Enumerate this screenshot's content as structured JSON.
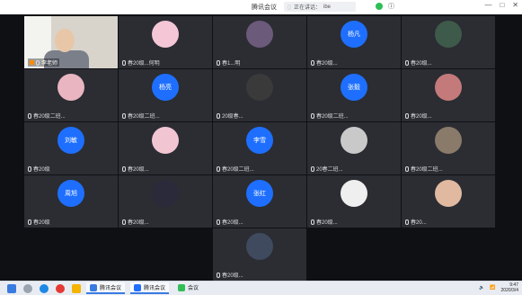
{
  "window": {
    "title": "腾讯会议",
    "speaking_label": "正在讲话：",
    "speaking_name": "ibe",
    "controls": [
      "—",
      "□",
      "✕"
    ]
  },
  "participants": [
    {
      "name": "李老师",
      "type": "video",
      "host": true
    },
    {
      "name": "春20级...何明",
      "type": "avatar",
      "color": "#f5c6d6"
    },
    {
      "name": "春1...明",
      "type": "avatar",
      "color": "#6b5a7a"
    },
    {
      "name": "春20级...",
      "type": "text",
      "avatar_text": "杨凡"
    },
    {
      "name": "春20级...",
      "type": "avatar",
      "color": "#3d5a4a"
    },
    {
      "name": "春20级二班...",
      "type": "avatar",
      "color": "#e8b5c0"
    },
    {
      "name": "春20级二班...",
      "type": "text",
      "avatar_text": "杨亮"
    },
    {
      "name": "20级春...",
      "type": "avatar",
      "color": "#3a3a3a"
    },
    {
      "name": "春20级二班...",
      "type": "text",
      "avatar_text": "张毅"
    },
    {
      "name": "春20级...",
      "type": "avatar",
      "color": "#c47a7a"
    },
    {
      "name": "春20级",
      "type": "text",
      "avatar_text": "刘敏"
    },
    {
      "name": "春20级...",
      "type": "avatar",
      "color": "#f2c5d2"
    },
    {
      "name": "春20级二班...",
      "type": "text",
      "avatar_text": "李雪"
    },
    {
      "name": "20春二班...",
      "type": "avatar",
      "color": "#c9c9c9"
    },
    {
      "name": "春20级二班...",
      "type": "avatar",
      "color": "#8a7a6a"
    },
    {
      "name": "春20级",
      "type": "text",
      "avatar_text": "周旭"
    },
    {
      "name": "春20级...",
      "type": "avatar",
      "color": "#2a2a3a"
    },
    {
      "name": "春20级...",
      "type": "text",
      "avatar_text": "张红"
    },
    {
      "name": "春20级...",
      "type": "avatar",
      "color": "#efefef"
    },
    {
      "name": "春20...",
      "type": "avatar",
      "color": "#e0b9a0"
    },
    {
      "name": "春20级...",
      "type": "avatar",
      "color": "#3f4a5e"
    }
  ],
  "taskbar": {
    "apps": [
      {
        "label": "腾讯会议",
        "icon_color": "#3a7be0"
      },
      {
        "label": "腾讯会议",
        "icon_color": "#1e6fff"
      },
      {
        "label": "会议",
        "icon_color": "#2fbf55"
      }
    ],
    "time": "9:47",
    "date": "2020/3/4"
  }
}
